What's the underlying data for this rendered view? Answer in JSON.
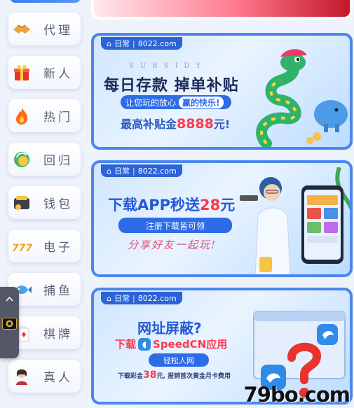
{
  "sidebar": {
    "items": [
      {
        "label": "代理",
        "icon": "handshake-icon"
      },
      {
        "label": "新人",
        "icon": "gift-icon"
      },
      {
        "label": "热门",
        "icon": "fire-icon"
      },
      {
        "label": "回归",
        "icon": "return-icon"
      },
      {
        "label": "钱包",
        "icon": "wallet-icon"
      },
      {
        "label": "电子",
        "icon": "slot-777-icon"
      },
      {
        "label": "捕鱼",
        "icon": "fish-icon"
      },
      {
        "label": "棋牌",
        "icon": "cards-icon"
      },
      {
        "label": "真人",
        "icon": "live-dealer-icon"
      }
    ]
  },
  "banners": [
    {
      "tag_type": "日常",
      "tag_site": "8022.com",
      "subsidy": "SUBSIDY",
      "headline": "每日存款 掉单补贴",
      "pill_text": "让您玩的放心",
      "pill_highlight": "赢的快乐!",
      "max_prefix": "最高补贴金",
      "max_value": "8888",
      "max_suffix": "元!"
    },
    {
      "tag_type": "日常",
      "tag_site": "8022.com",
      "headline_prefix": "下载APP秒送",
      "headline_value": "28",
      "headline_suffix": "元",
      "pill_text": "注册下载皆可领",
      "script_text": "分享好友一起玩!"
    },
    {
      "tag_type": "日常",
      "tag_site": "8022.com",
      "headline": "网址屏蔽?",
      "download_prefix": "下载",
      "download_app": "SpeedCN应用",
      "pill_text": "轻松人网",
      "note_prefix": "下载彩金",
      "note_value": "38",
      "note_suffix": "元, 报销首次黄金月卡费用"
    }
  ],
  "watermark": "79bo.com",
  "colors": {
    "accent": "#2e6be6",
    "banner_border": "#4a86f0",
    "highlight_red": "#ff3a4e"
  }
}
